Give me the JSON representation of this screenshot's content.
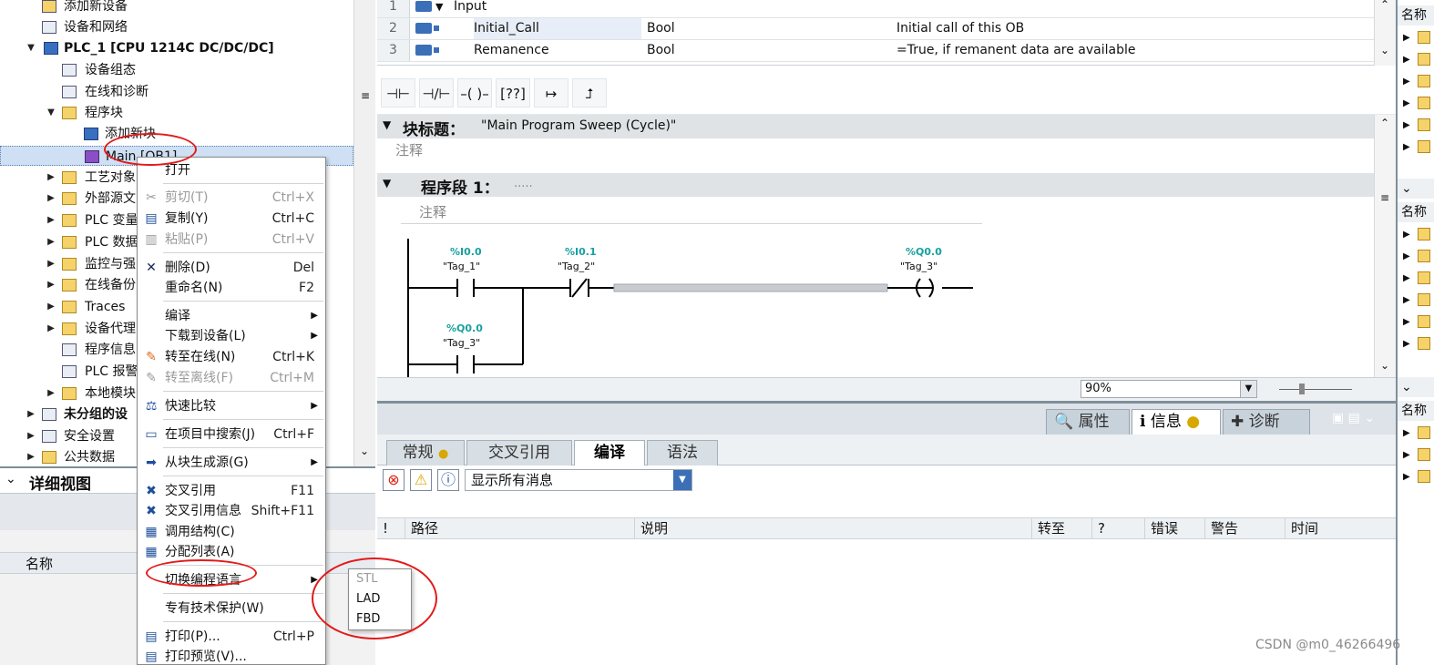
{
  "tree": {
    "items": [
      {
        "label": "添加新设备",
        "arrow": ""
      },
      {
        "label": "设备和网络",
        "arrow": ""
      },
      {
        "label": "PLC_1 [CPU 1214C DC/DC/DC]",
        "arrow": "▼"
      },
      {
        "label": "设备组态",
        "arrow": ""
      },
      {
        "label": "在线和诊断",
        "arrow": ""
      },
      {
        "label": "程序块",
        "arrow": "▼"
      },
      {
        "label": "添加新块",
        "arrow": ""
      },
      {
        "label": "Main [OB1]",
        "arrow": ""
      },
      {
        "label": "工艺对象",
        "arrow": "▶"
      },
      {
        "label": "外部源文",
        "arrow": "▶"
      },
      {
        "label": "PLC 变量",
        "arrow": "▶"
      },
      {
        "label": "PLC 数据",
        "arrow": "▶"
      },
      {
        "label": "监控与强",
        "arrow": "▶"
      },
      {
        "label": "在线备份",
        "arrow": "▶"
      },
      {
        "label": "Traces",
        "arrow": "▶"
      },
      {
        "label": "设备代理",
        "arrow": "▶"
      },
      {
        "label": "程序信息",
        "arrow": ""
      },
      {
        "label": "PLC 报警",
        "arrow": ""
      },
      {
        "label": "本地模块",
        "arrow": "▶"
      },
      {
        "label": "未分组的设",
        "arrow": "▶"
      },
      {
        "label": "安全设置",
        "arrow": "▶"
      },
      {
        "label": "公共数据",
        "arrow": "▶"
      }
    ]
  },
  "detail": {
    "title": "详细视图",
    "col_name": "名称"
  },
  "interface": {
    "rows": [
      {
        "num": "1",
        "name": "Input",
        "type": "",
        "comment": ""
      },
      {
        "num": "2",
        "name": "Initial_Call",
        "type": "Bool",
        "comment": "Initial call of this OB"
      },
      {
        "num": "3",
        "name": "Remanence",
        "type": "Bool",
        "comment": "=True, if remanent data are available"
      }
    ]
  },
  "lad_toolbar": {
    "buttons": [
      {
        "glyph": "⊣⊢",
        "name": "no-contact-button"
      },
      {
        "glyph": "⊣/⊢",
        "name": "nc-contact-button"
      },
      {
        "glyph": "–( )–",
        "name": "coil-button"
      },
      {
        "glyph": "[??]",
        "name": "empty-box-button"
      },
      {
        "glyph": "↦",
        "name": "open-branch-button"
      },
      {
        "glyph": "⮥",
        "name": "close-branch-button"
      }
    ]
  },
  "editor": {
    "block_title_label": "块标题：",
    "block_title_value": "\"Main Program Sweep (Cycle)\"",
    "block_comment": "注释",
    "network_label": "程序段 1：",
    "network_dots": ".....",
    "network_comment": "注释",
    "contact1_addr": "%I0.0",
    "contact1_tag": "\"Tag_1\"",
    "contact2_addr": "%I0.1",
    "contact2_tag": "\"Tag_2\"",
    "coil_addr": "%Q0.0",
    "coil_tag": "\"Tag_3\"",
    "contact3_addr": "%Q0.0",
    "contact3_tag": "\"Tag_3\"",
    "zoom": "90%"
  },
  "inspector": {
    "top_tabs": [
      "属性",
      "信息",
      "诊断"
    ],
    "tabs": [
      "常规",
      "交叉引用",
      "编译",
      "语法"
    ],
    "filter": "显示所有消息",
    "columns": [
      "!",
      "路径",
      "说明",
      "转至",
      "?",
      "错误",
      "警告",
      "时间"
    ]
  },
  "context_menu": {
    "items": [
      {
        "label": "打开",
        "shortcut": "",
        "icon": "",
        "disabled": false,
        "sub": false
      },
      {
        "label": "剪切(T)",
        "shortcut": "Ctrl+X",
        "icon": "✂",
        "disabled": true,
        "sub": false
      },
      {
        "label": "复制(Y)",
        "shortcut": "Ctrl+C",
        "icon": "▤",
        "disabled": false,
        "sub": false
      },
      {
        "label": "粘贴(P)",
        "shortcut": "Ctrl+V",
        "icon": "▥",
        "disabled": true,
        "sub": false
      },
      {
        "label": "删除(D)",
        "shortcut": "Del",
        "icon": "✕",
        "disabled": false,
        "sub": false
      },
      {
        "label": "重命名(N)",
        "shortcut": "F2",
        "icon": "",
        "disabled": false,
        "sub": false
      },
      {
        "label": "编译",
        "shortcut": "",
        "icon": "",
        "disabled": false,
        "sub": true
      },
      {
        "label": "下载到设备(L)",
        "shortcut": "",
        "icon": "",
        "disabled": false,
        "sub": true
      },
      {
        "label": "转至在线(N)",
        "shortcut": "Ctrl+K",
        "icon": "✎",
        "disabled": false,
        "sub": false
      },
      {
        "label": "转至离线(F)",
        "shortcut": "Ctrl+M",
        "icon": "✎",
        "disabled": true,
        "sub": false
      },
      {
        "label": "快速比较",
        "shortcut": "",
        "icon": "⚖",
        "disabled": false,
        "sub": true
      },
      {
        "label": "在项目中搜索(J)",
        "shortcut": "Ctrl+F",
        "icon": "▭",
        "disabled": false,
        "sub": false
      },
      {
        "label": "从块生成源(G)",
        "shortcut": "",
        "icon": "➡",
        "disabled": false,
        "sub": true
      },
      {
        "label": "交叉引用",
        "shortcut": "F11",
        "icon": "✖",
        "disabled": false,
        "sub": false
      },
      {
        "label": "交叉引用信息",
        "shortcut": "Shift+F11",
        "icon": "✖",
        "disabled": false,
        "sub": false
      },
      {
        "label": "调用结构(C)",
        "shortcut": "",
        "icon": "▦",
        "disabled": false,
        "sub": false
      },
      {
        "label": "分配列表(A)",
        "shortcut": "",
        "icon": "▦",
        "disabled": false,
        "sub": false
      },
      {
        "label": "切换编程语言",
        "shortcut": "",
        "icon": "",
        "disabled": false,
        "sub": true
      },
      {
        "label": "专有技术保护(W)",
        "shortcut": "",
        "icon": "",
        "disabled": false,
        "sub": false
      },
      {
        "label": "打印(P)...",
        "shortcut": "Ctrl+P",
        "icon": "▤",
        "disabled": false,
        "sub": false
      },
      {
        "label": "打印预览(V)...",
        "shortcut": "",
        "icon": "▤",
        "disabled": false,
        "sub": false
      }
    ]
  },
  "submenu": {
    "items": [
      {
        "label": "STL",
        "disabled": true
      },
      {
        "label": "LAD",
        "disabled": false
      },
      {
        "label": "FBD",
        "disabled": false
      }
    ]
  },
  "right_panel": {
    "header": "名称"
  },
  "watermark": "CSDN @m0_46266496",
  "colors": {
    "highlight": "#e31a1a",
    "tag_addr": "#1aa0a0",
    "accent": "#3b6fb8"
  }
}
